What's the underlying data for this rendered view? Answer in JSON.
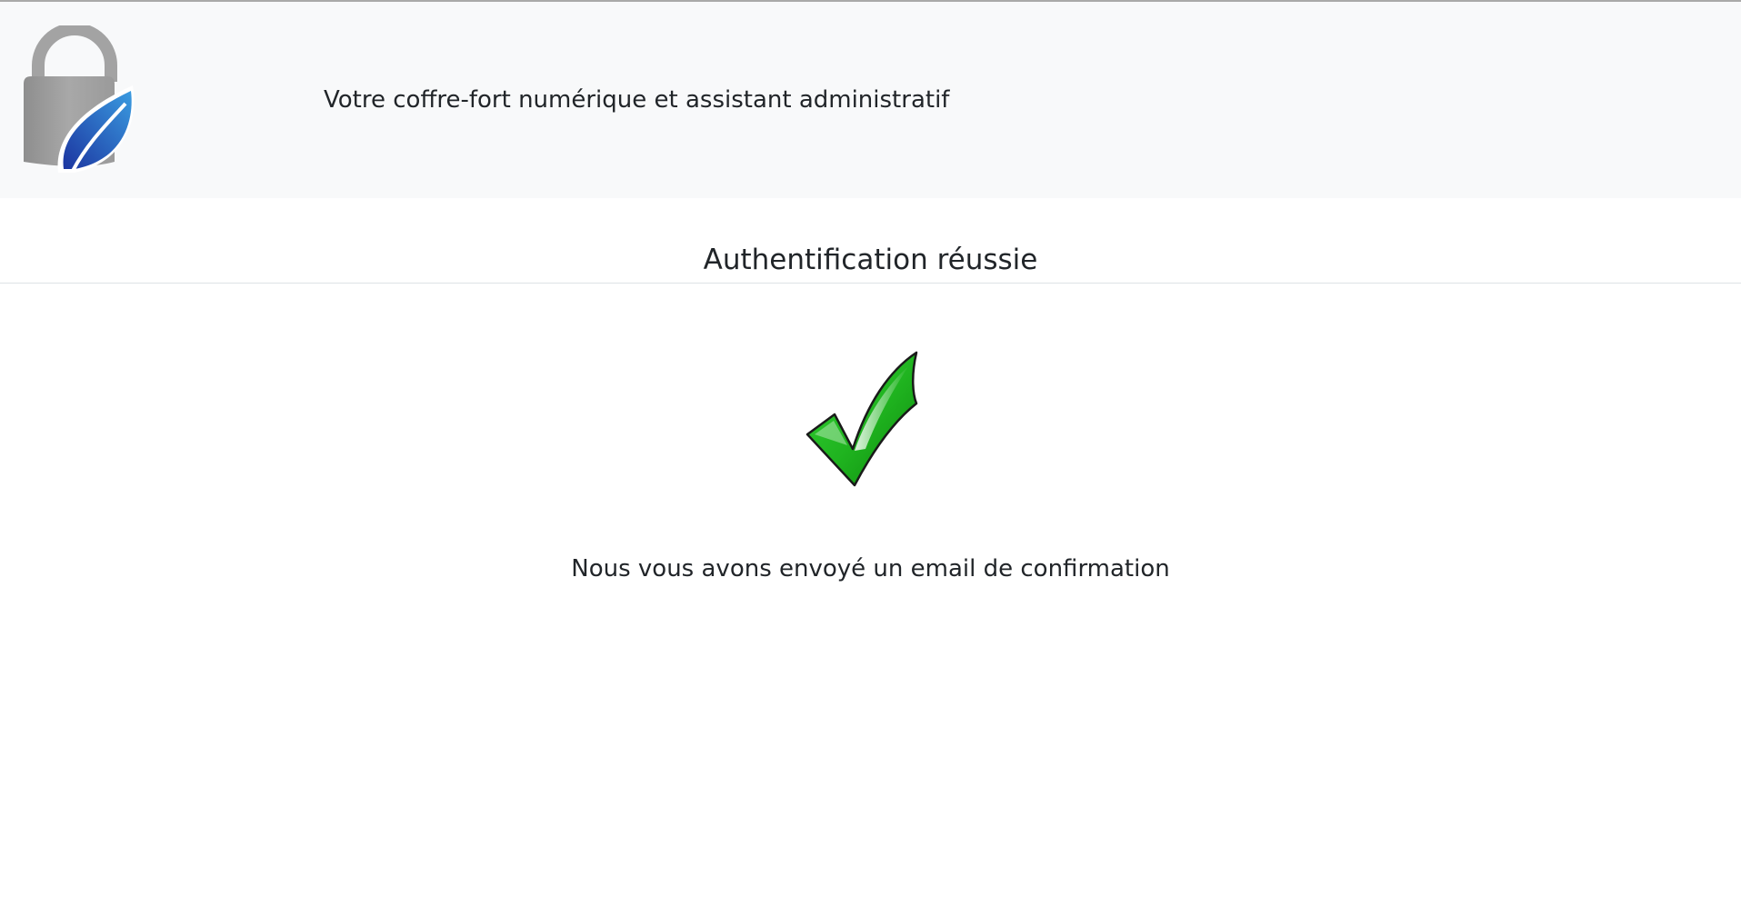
{
  "header": {
    "logo_icon": "padlock-leaf-logo-icon",
    "tagline": "Votre coffre-fort numérique et assistant administratif"
  },
  "main": {
    "title": "Authentification réussie",
    "status_icon": "green-checkmark-icon",
    "message": "Nous vous avons envoyé un email de confirmation"
  },
  "colors": {
    "header_bg": "#f8f9fa",
    "lock_gray": "#9e9e9e",
    "leaf_blue_light": "#3a8fd8",
    "leaf_blue_dark": "#1e3fa8",
    "check_green": "#22b422",
    "text": "#212529"
  }
}
